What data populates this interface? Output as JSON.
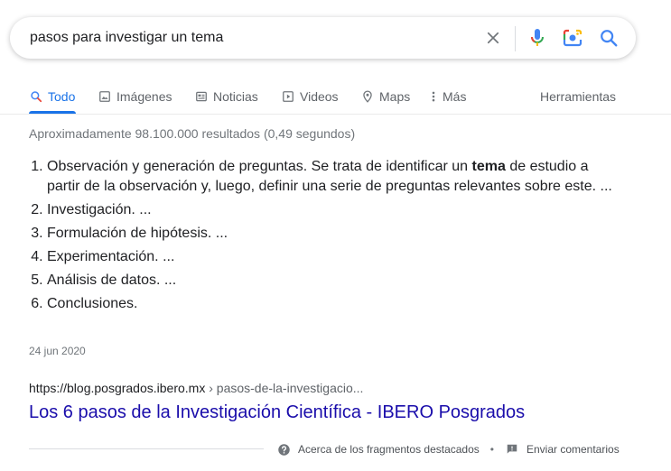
{
  "search": {
    "query": "pasos para investigar un tema"
  },
  "tabs": [
    {
      "label": "Todo",
      "icon": "search-icon",
      "active": true
    },
    {
      "label": "Imágenes",
      "icon": "image-icon"
    },
    {
      "label": "Noticias",
      "icon": "news-icon"
    },
    {
      "label": "Videos",
      "icon": "video-icon"
    },
    {
      "label": "Maps",
      "icon": "map-pin-icon"
    },
    {
      "label": "Más",
      "icon": "more-vert-icon"
    }
  ],
  "tools_label": "Herramientas",
  "stats": "Aproximadamente 98.100.000 resultados (0,49 segundos)",
  "snippet": {
    "items": [
      {
        "pre": "Observación y generación de preguntas. Se trata de identificar un ",
        "bold": "tema",
        "post": " de estudio a partir de la observación y, luego, definir una serie de preguntas relevantes sobre este. ..."
      },
      {
        "pre": "Investigación. ...",
        "bold": "",
        "post": ""
      },
      {
        "pre": "Formulación de hipótesis. ...",
        "bold": "",
        "post": ""
      },
      {
        "pre": "Experimentación. ...",
        "bold": "",
        "post": ""
      },
      {
        "pre": "Análisis de datos. ...",
        "bold": "",
        "post": ""
      },
      {
        "pre": "Conclusiones.",
        "bold": "",
        "post": ""
      }
    ],
    "date": "24 jun 2020"
  },
  "result": {
    "cite_domain": "https://blog.posgrados.ibero.mx",
    "cite_path": " › pasos-de-la-investigacio...",
    "title": "Los 6 pasos de la Investigación Científica - IBERO Posgrados"
  },
  "footer": {
    "about_label": "Acerca de los fragmentos destacados",
    "separator": "•",
    "feedback_label": "Enviar comentarios"
  },
  "colors": {
    "accent": "#1a73e8",
    "link": "#1a0dab",
    "muted": "#70757a"
  }
}
